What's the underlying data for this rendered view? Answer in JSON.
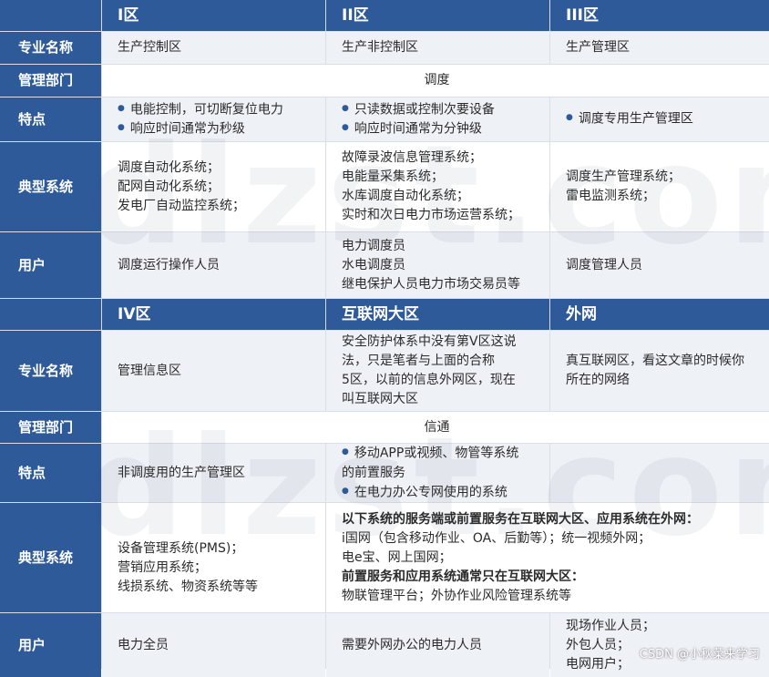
{
  "watermark": "dlzst.com",
  "credit": "CSDN @小秋菜来学习",
  "top": {
    "headers": [
      "I区",
      "II区",
      "III区"
    ],
    "rows": {
      "major_label": "专业名称",
      "major": [
        "生产控制区",
        "生产非控制区",
        "生产管理区"
      ],
      "dept_label": "管理部门",
      "dept": "调度",
      "feature_label": "特点",
      "features": [
        [
          "电能控制，可切断复位电力",
          "响应时间通常为秒级"
        ],
        [
          "只读数据或控制次要设备",
          "响应时间通常为分钟级"
        ],
        [
          "调度专用生产管理区"
        ]
      ],
      "system_label": "典型系统",
      "systems": [
        [
          "调度自动化系统；",
          "配网自动化系统；",
          "发电厂自动监控系统；"
        ],
        [
          "故障录波信息管理系统；",
          "电能量采集系统；",
          "水库调度自动化系统；",
          "实时和次日电力市场运营系统；"
        ],
        [
          "调度生产管理系统；",
          "雷电监测系统；"
        ]
      ],
      "user_label": "用户",
      "users": [
        [
          "调度运行操作人员"
        ],
        [
          "电力调度员",
          "水电调度员",
          "继电保护人员电力市场交易员等"
        ],
        [
          "调度管理人员"
        ]
      ]
    }
  },
  "bottom": {
    "headers": [
      "IV区",
      "互联网大区",
      "外网"
    ],
    "rows": {
      "major_label": "专业名称",
      "major": [
        [
          "管理信息区"
        ],
        [
          "安全防护体系中没有第V区这说",
          "法，只是笔者与上面的合称",
          "5区，以前的信息外网区，现在",
          "叫互联网大区"
        ],
        [
          "真互联网区，看这文章的时候你",
          "所在的网络"
        ]
      ],
      "dept_label": "管理部门",
      "dept": "信通",
      "feature_label": "特点",
      "features": [
        [
          "非调度用的生产管理区"
        ],
        [
          "移动APP或视频、物管等系统",
          "的前置服务",
          "在电力办公专网使用的系统"
        ],
        []
      ],
      "system_label": "典型系统",
      "systems_col1": [
        "设备管理系统(PMS)；",
        "营销应用系统；",
        "线损系统、物资系统等等"
      ],
      "systems_merged": [
        "以下系统的服务端或前置服务在互联网大区、应用系统在外网：",
        "i国网（包含移动作业、OA、后勤等）；统一视频外网；",
        "电e宝、网上国网；",
        "前置服务和应用系统通常只在互联网大区：",
        "物联管理平台；外协作业风险管理系统等"
      ],
      "user_label": "用户",
      "users": [
        [
          "电力全员"
        ],
        [
          "需要外网办公的电力人员"
        ],
        [
          "现场作业人员；",
          "外包人员；",
          "电网用户；"
        ]
      ]
    }
  }
}
